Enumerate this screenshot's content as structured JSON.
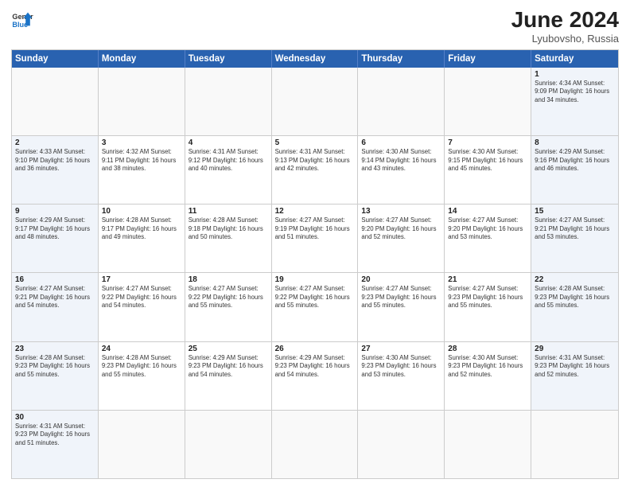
{
  "header": {
    "logo_general": "General",
    "logo_blue": "Blue",
    "title": "June 2024",
    "subtitle": "Lyubovsho, Russia"
  },
  "days_of_week": [
    "Sunday",
    "Monday",
    "Tuesday",
    "Wednesday",
    "Thursday",
    "Friday",
    "Saturday"
  ],
  "weeks": [
    [
      {
        "day": "",
        "info": "",
        "empty": true
      },
      {
        "day": "",
        "info": "",
        "empty": true
      },
      {
        "day": "",
        "info": "",
        "empty": true
      },
      {
        "day": "",
        "info": "",
        "empty": true
      },
      {
        "day": "",
        "info": "",
        "empty": true
      },
      {
        "day": "",
        "info": "",
        "empty": true
      },
      {
        "day": "1",
        "info": "Sunrise: 4:34 AM\nSunset: 9:09 PM\nDaylight: 16 hours and 34 minutes.",
        "weekend": true
      }
    ],
    [
      {
        "day": "2",
        "info": "Sunrise: 4:33 AM\nSunset: 9:10 PM\nDaylight: 16 hours and 36 minutes.",
        "weekend": true
      },
      {
        "day": "3",
        "info": "Sunrise: 4:32 AM\nSunset: 9:11 PM\nDaylight: 16 hours and 38 minutes.",
        "weekend": false
      },
      {
        "day": "4",
        "info": "Sunrise: 4:31 AM\nSunset: 9:12 PM\nDaylight: 16 hours and 40 minutes.",
        "weekend": false
      },
      {
        "day": "5",
        "info": "Sunrise: 4:31 AM\nSunset: 9:13 PM\nDaylight: 16 hours and 42 minutes.",
        "weekend": false
      },
      {
        "day": "6",
        "info": "Sunrise: 4:30 AM\nSunset: 9:14 PM\nDaylight: 16 hours and 43 minutes.",
        "weekend": false
      },
      {
        "day": "7",
        "info": "Sunrise: 4:30 AM\nSunset: 9:15 PM\nDaylight: 16 hours and 45 minutes.",
        "weekend": false
      },
      {
        "day": "8",
        "info": "Sunrise: 4:29 AM\nSunset: 9:16 PM\nDaylight: 16 hours and 46 minutes.",
        "weekend": true
      }
    ],
    [
      {
        "day": "9",
        "info": "Sunrise: 4:29 AM\nSunset: 9:17 PM\nDaylight: 16 hours and 48 minutes.",
        "weekend": true
      },
      {
        "day": "10",
        "info": "Sunrise: 4:28 AM\nSunset: 9:17 PM\nDaylight: 16 hours and 49 minutes.",
        "weekend": false
      },
      {
        "day": "11",
        "info": "Sunrise: 4:28 AM\nSunset: 9:18 PM\nDaylight: 16 hours and 50 minutes.",
        "weekend": false
      },
      {
        "day": "12",
        "info": "Sunrise: 4:27 AM\nSunset: 9:19 PM\nDaylight: 16 hours and 51 minutes.",
        "weekend": false
      },
      {
        "day": "13",
        "info": "Sunrise: 4:27 AM\nSunset: 9:20 PM\nDaylight: 16 hours and 52 minutes.",
        "weekend": false
      },
      {
        "day": "14",
        "info": "Sunrise: 4:27 AM\nSunset: 9:20 PM\nDaylight: 16 hours and 53 minutes.",
        "weekend": false
      },
      {
        "day": "15",
        "info": "Sunrise: 4:27 AM\nSunset: 9:21 PM\nDaylight: 16 hours and 53 minutes.",
        "weekend": true
      }
    ],
    [
      {
        "day": "16",
        "info": "Sunrise: 4:27 AM\nSunset: 9:21 PM\nDaylight: 16 hours and 54 minutes.",
        "weekend": true
      },
      {
        "day": "17",
        "info": "Sunrise: 4:27 AM\nSunset: 9:22 PM\nDaylight: 16 hours and 54 minutes.",
        "weekend": false
      },
      {
        "day": "18",
        "info": "Sunrise: 4:27 AM\nSunset: 9:22 PM\nDaylight: 16 hours and 55 minutes.",
        "weekend": false
      },
      {
        "day": "19",
        "info": "Sunrise: 4:27 AM\nSunset: 9:22 PM\nDaylight: 16 hours and 55 minutes.",
        "weekend": false
      },
      {
        "day": "20",
        "info": "Sunrise: 4:27 AM\nSunset: 9:23 PM\nDaylight: 16 hours and 55 minutes.",
        "weekend": false
      },
      {
        "day": "21",
        "info": "Sunrise: 4:27 AM\nSunset: 9:23 PM\nDaylight: 16 hours and 55 minutes.",
        "weekend": false
      },
      {
        "day": "22",
        "info": "Sunrise: 4:28 AM\nSunset: 9:23 PM\nDaylight: 16 hours and 55 minutes.",
        "weekend": true
      }
    ],
    [
      {
        "day": "23",
        "info": "Sunrise: 4:28 AM\nSunset: 9:23 PM\nDaylight: 16 hours and 55 minutes.",
        "weekend": true
      },
      {
        "day": "24",
        "info": "Sunrise: 4:28 AM\nSunset: 9:23 PM\nDaylight: 16 hours and 55 minutes.",
        "weekend": false
      },
      {
        "day": "25",
        "info": "Sunrise: 4:29 AM\nSunset: 9:23 PM\nDaylight: 16 hours and 54 minutes.",
        "weekend": false
      },
      {
        "day": "26",
        "info": "Sunrise: 4:29 AM\nSunset: 9:23 PM\nDaylight: 16 hours and 54 minutes.",
        "weekend": false
      },
      {
        "day": "27",
        "info": "Sunrise: 4:30 AM\nSunset: 9:23 PM\nDaylight: 16 hours and 53 minutes.",
        "weekend": false
      },
      {
        "day": "28",
        "info": "Sunrise: 4:30 AM\nSunset: 9:23 PM\nDaylight: 16 hours and 52 minutes.",
        "weekend": false
      },
      {
        "day": "29",
        "info": "Sunrise: 4:31 AM\nSunset: 9:23 PM\nDaylight: 16 hours and 52 minutes.",
        "weekend": true
      }
    ],
    [
      {
        "day": "30",
        "info": "Sunrise: 4:31 AM\nSunset: 9:23 PM\nDaylight: 16 hours and 51 minutes.",
        "weekend": true
      },
      {
        "day": "",
        "info": "",
        "empty": true
      },
      {
        "day": "",
        "info": "",
        "empty": true
      },
      {
        "day": "",
        "info": "",
        "empty": true
      },
      {
        "day": "",
        "info": "",
        "empty": true
      },
      {
        "day": "",
        "info": "",
        "empty": true
      },
      {
        "day": "",
        "info": "",
        "empty": true
      }
    ]
  ]
}
